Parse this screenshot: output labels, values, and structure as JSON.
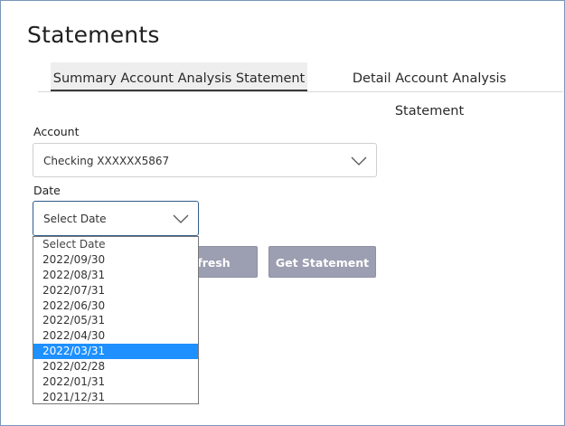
{
  "page": {
    "title": "Statements"
  },
  "tabs": [
    {
      "label": "Summary Account Analysis Statement",
      "active": true
    },
    {
      "label": "Detail Account Analysis Statement",
      "active": false
    }
  ],
  "account": {
    "label": "Account",
    "value": "Checking XXXXXX5867"
  },
  "date": {
    "label": "Date",
    "value": "Select Date",
    "options": [
      "Select Date",
      "2022/09/30",
      "2022/08/31",
      "2022/07/31",
      "2022/06/30",
      "2022/05/31",
      "2022/04/30",
      "2022/03/31",
      "2022/02/28",
      "2022/01/31",
      "2021/12/31"
    ],
    "highlighted": "2022/03/31"
  },
  "buttons": {
    "refresh_label": "Refresh",
    "refresh_visible_label": "fresh",
    "get_statement_label": "Get Statement"
  },
  "colors": {
    "button_bg": "#9c9eb1",
    "highlight": "#1e90ff",
    "focus_border": "#2f5d8c"
  }
}
